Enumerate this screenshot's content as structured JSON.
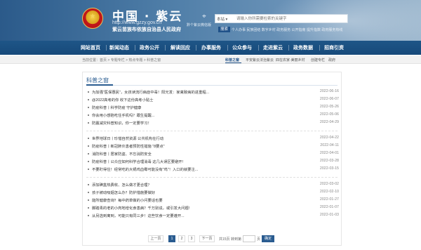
{
  "header": {
    "emblem_glyph": "★",
    "title": "中国 · 紫云",
    "url": "http://www.gzzy.gov.cn",
    "subtitle": "紫云苗族布依族自治县人民政府",
    "location_icon": "⌖",
    "location_text": "黔个紫云微信版",
    "search": {
      "scope": "本站 ▾",
      "placeholder": "请输入你所需要检索的关键字",
      "button": "搜索",
      "hot_words": "个人办事  民族团结  数字乡村  政务服务  公开指南  提升指数  政府服务热线"
    }
  },
  "nav": [
    "网站首页",
    "新闻动态",
    "政务公开",
    "解读回应",
    "办事服务",
    "公众参与",
    "走进紫云",
    "政务数据",
    "招商引资"
  ],
  "breadcrumb": "当前位置：首页 > 专题专栏 > 热点专题 > 科普之窗",
  "tabs": [
    "科普之窗",
    "平安紫云法治紫云",
    "四在农家·美丽乡村",
    "创建专栏",
    "政府"
  ],
  "card": {
    "title": "科普之窗",
    "groups": [
      [
        {
          "text": "为加强\"医保惠民\"，女孩读流行病症中毒！阳光发：家禽致病的进重程...",
          "date": "2022-06-16"
        },
        {
          "text": "@2022高考的你 收下这份高考小贴士",
          "date": "2022-06-07"
        },
        {
          "text": "防疫科普丨科学防疫 守护健康",
          "date": "2022-05-26"
        },
        {
          "text": "你会用小感陷吃住手机吗？跟生提醒...",
          "date": "2022-05-06"
        },
        {
          "text": "防震减灾科普知识，你一定要学习！",
          "date": "2022-04-29"
        }
      ],
      [
        {
          "text": "世界地球日丨珍惜自然资源 公共机构在行动",
          "date": "2022-04-22"
        },
        {
          "text": "防疫科普丨新冠肺炎患者预防性措施 \"8要点\"",
          "date": "2022-04-11"
        },
        {
          "text": "消防科普丨居家防盗、不忘消防安全",
          "date": "2022-04-01"
        },
        {
          "text": "防疫科普丨公众应如何科学合理消毒 这几大误区要避开!",
          "date": "2022-03-28"
        },
        {
          "text": "不要盯得住！经常吃的大锅鸡血霉可能没有\"鸡\"！入口的就要注...",
          "date": "2022-03-15"
        }
      ],
      [
        {
          "text": "添加碘盒热费收、怎么做才更合理？",
          "date": "2022-03-02"
        },
        {
          "text": "孩子被动吸烟怎么办？防护措施要做好",
          "date": "2022-02-10"
        },
        {
          "text": "能所健康查询？每中药草做的小问要话也要",
          "date": "2022-01-27"
        },
        {
          "text": "脚踏青的老的小肉地增化食患病？千万别说，或引发大问题!",
          "date": "2022-01-07"
        },
        {
          "text": "从另选到离到，可能只有同三步！这些饮食一定要遵开...",
          "date": "2022-01-03"
        }
      ]
    ]
  },
  "pagination": {
    "prev": "上一页",
    "pages": [
      "1",
      "2",
      "3"
    ],
    "next": "下一页",
    "total": "共15页 转到第",
    "page_unit": "页",
    "go": "确定"
  }
}
